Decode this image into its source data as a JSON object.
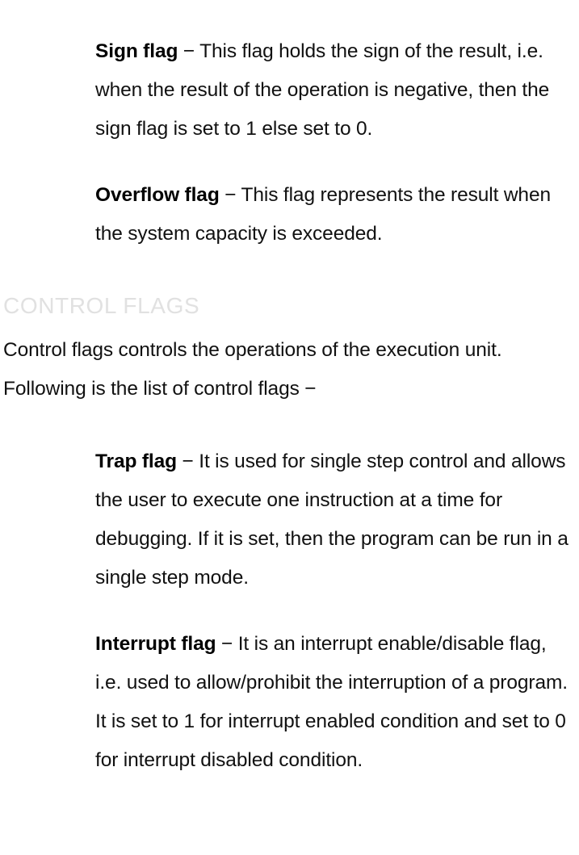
{
  "document": {
    "background_color": "#ffffff",
    "body_text_color": "#111111",
    "heading_color": "#e1e1e1",
    "dash_glyph": "−"
  },
  "blocks": {
    "sign_flag": {
      "term": "Sign flag",
      "dash": " − ",
      "description": "This flag holds the sign of the result, i.e. when the result of the operation is negative, then the sign flag is set to 1 else set to 0."
    },
    "overflow_flag": {
      "term": "Overflow flag",
      "dash": " − ",
      "description": "This flag represents the result when the system capacity is exceeded."
    },
    "control_flags_heading": "CONTROL FLAGS",
    "control_flags_intro": "Control flags controls the operations of the execution unit. Following is the list of control flags −",
    "trap_flag": {
      "term": "Trap flag",
      "dash": " − ",
      "description": "It is used for single step control and allows the user to execute one instruction at a time for debugging. If it is set, then the program can be run in a single step mode."
    },
    "interrupt_flag": {
      "term": "Interrupt flag",
      "dash": " − ",
      "description": "It is an interrupt enable/disable flag, i.e. used to allow/prohibit the interruption of a program. It is set to 1 for interrupt enabled condition and set to 0 for interrupt disabled condition."
    }
  }
}
